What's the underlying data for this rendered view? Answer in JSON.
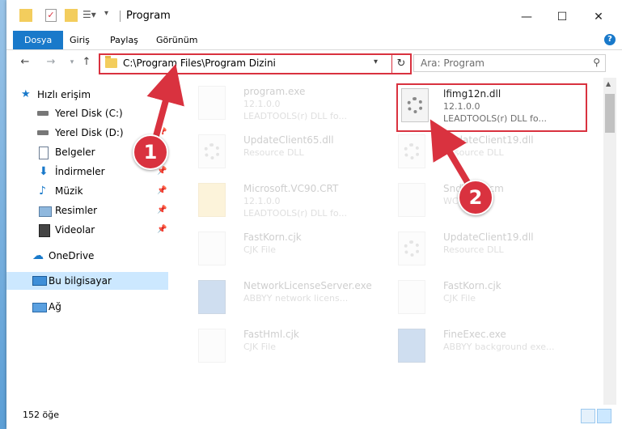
{
  "window": {
    "title": "Program",
    "minimize": "—",
    "maximize": "☐",
    "close": "✕"
  },
  "ribbon": {
    "tabs": [
      "Dosya",
      "Giriş",
      "Paylaş",
      "Görünüm"
    ],
    "help": "?"
  },
  "address": {
    "path": "C:\\Program Files\\Program Dizini",
    "search_placeholder": "Ara: Program"
  },
  "nav": {
    "items": [
      {
        "label": "Hızlı erişim",
        "icon": "star-icon"
      },
      {
        "label": "Yerel Disk (C:)",
        "icon": "drive-icon"
      },
      {
        "label": "Yerel Disk (D:)",
        "icon": "drive-icon"
      },
      {
        "label": "Belgeler",
        "icon": "documents-icon"
      },
      {
        "label": "İndirmeler",
        "icon": "download-icon"
      },
      {
        "label": "Müzik",
        "icon": "music-icon"
      },
      {
        "label": "Resimler",
        "icon": "pictures-icon"
      },
      {
        "label": "Videolar",
        "icon": "video-icon"
      },
      {
        "label": "OneDrive",
        "icon": "cloud-icon"
      },
      {
        "label": "Bu bilgisayar",
        "icon": "computer-icon"
      },
      {
        "label": "Ağ",
        "icon": "network-icon"
      }
    ]
  },
  "files": [
    {
      "name": "program.exe",
      "l2": "12.1.0.0",
      "l3": "LEADTOOLS(r) DLL fo..."
    },
    {
      "name": "lfimg12n.dll",
      "l2": "12.1.0.0",
      "l3": "LEADTOOLS(r) DLL fo..."
    },
    {
      "name": "UpdateClient65.dll",
      "l2": "Resource DLL",
      "l3": ""
    },
    {
      "name": "UpdateClient19.dll",
      "l2": "Resource DLL",
      "l3": ""
    },
    {
      "name": "Microsoft.VC90.CRT",
      "l2": "12.1.0.0",
      "l3": "LEADTOOLS(r) DLL fo..."
    },
    {
      "name": "SndTo...wcm",
      "l2": "WCM",
      "l3": ""
    },
    {
      "name": "FastKorn.cjk",
      "l2": "CJK File",
      "l3": ""
    },
    {
      "name": "UpdateClient19.dll",
      "l2": "Resource DLL",
      "l3": ""
    },
    {
      "name": "NetworkLicenseServer.exe",
      "l2": "ABBYY network licens...",
      "l3": ""
    },
    {
      "name": "FastKorn.cjk",
      "l2": "CJK File",
      "l3": ""
    },
    {
      "name": "FastHml.cjk",
      "l2": "CJK File",
      "l3": ""
    },
    {
      "name": "FineExec.exe",
      "l2": "ABBYY background exe...",
      "l3": ""
    }
  ],
  "status": {
    "count": "152 öğe"
  },
  "annotations": {
    "step1": "1",
    "step2": "2"
  },
  "colors": {
    "accent": "#1979ca",
    "highlight": "#d9323f",
    "selection": "#cce8ff"
  }
}
